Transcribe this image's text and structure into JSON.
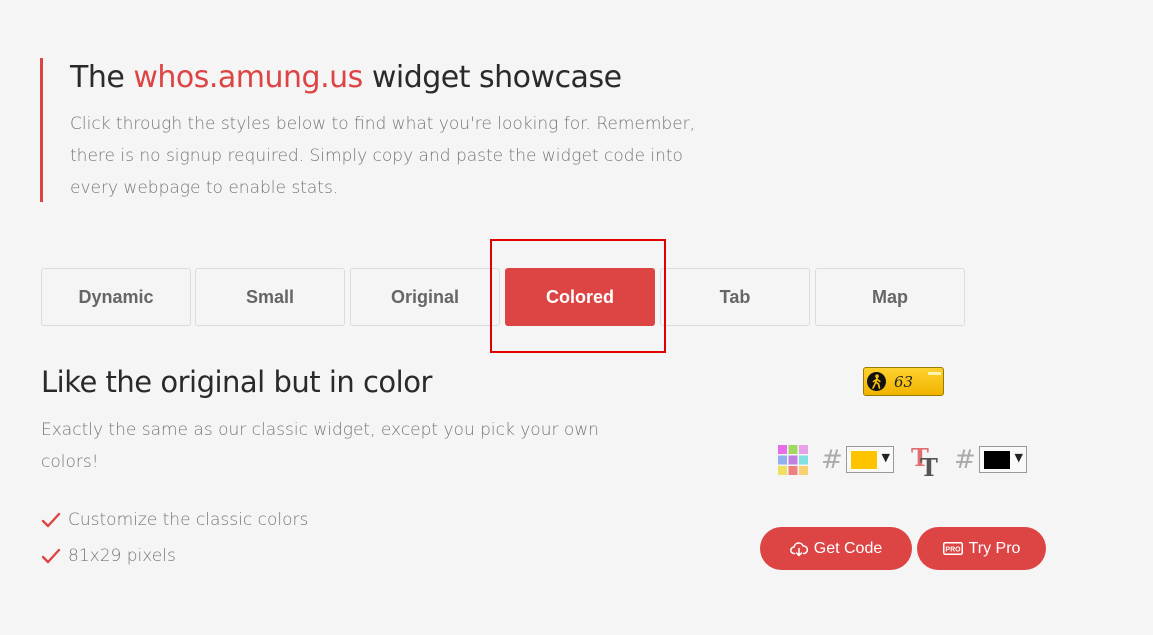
{
  "intro": {
    "title_prefix": "The ",
    "brand": "whos.amung.us",
    "title_suffix": " widget showcase",
    "text": "Click through the styles below to find what you're looking for. Remember, there is no signup required. Simply copy and paste the widget code into every webpage to enable stats."
  },
  "tabs": [
    {
      "label": "Dynamic",
      "active": false
    },
    {
      "label": "Small",
      "active": false
    },
    {
      "label": "Original",
      "active": false
    },
    {
      "label": "Colored",
      "active": true
    },
    {
      "label": "Tab",
      "active": false
    },
    {
      "label": "Map",
      "active": false
    }
  ],
  "section": {
    "title": "Like the original but in color",
    "description": "Exactly the same as our classic widget, except you pick your own colors!",
    "features": [
      "Customize the classic colors",
      "81x29 pixels"
    ]
  },
  "widget": {
    "count": "63",
    "background_color": "#FFC300",
    "text_color": "#000000"
  },
  "controls": {
    "hash_symbol": "#"
  },
  "buttons": {
    "get_code": "Get Code",
    "try_pro": "Try Pro",
    "pro_badge": "PRO"
  },
  "colors": {
    "accent": "#DD4444",
    "highlight": "#E00000"
  }
}
